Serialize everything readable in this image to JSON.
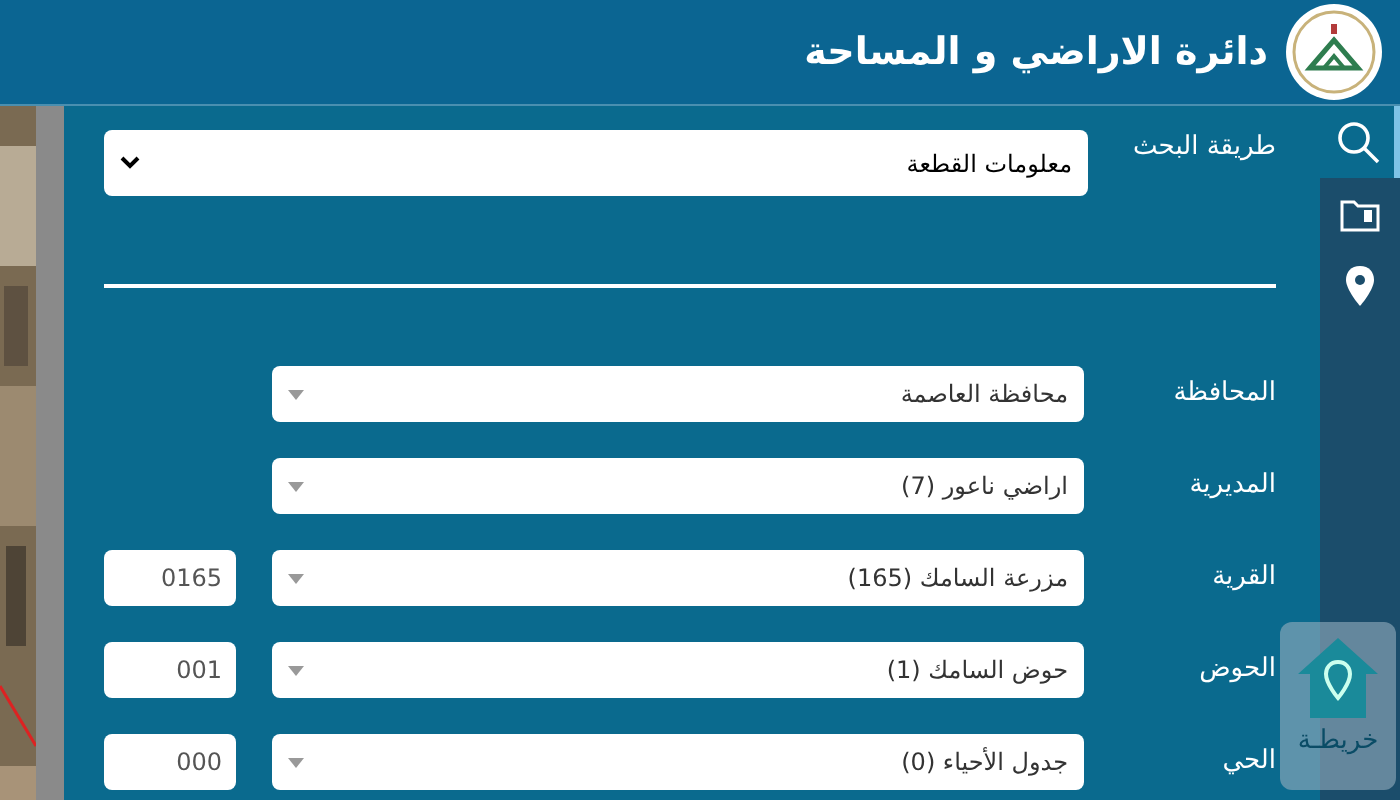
{
  "header": {
    "title": "دائرة الاراضي و المساحة"
  },
  "sidebar": {
    "items": [
      {
        "kind": "search",
        "selected": true
      },
      {
        "kind": "folder",
        "selected": false
      },
      {
        "kind": "pin",
        "selected": false
      }
    ]
  },
  "search_method": {
    "label": "طريقة البحث",
    "value": "معلومات القطعة"
  },
  "fields": [
    {
      "label": "المحافظة",
      "value": "محافظة العاصمة"
    },
    {
      "label": "المديرية",
      "value": "اراضي ناعور (7)"
    },
    {
      "label": "القرية",
      "value": "مزرعة السامك (165)",
      "code": "0165"
    },
    {
      "label": "الحوض",
      "value": "حوض السامك (1)",
      "code": "001"
    },
    {
      "label": "الحي",
      "value": "جدول الأحياء (0)",
      "code": "000"
    }
  ],
  "map_button": {
    "label": "خريطـة"
  }
}
